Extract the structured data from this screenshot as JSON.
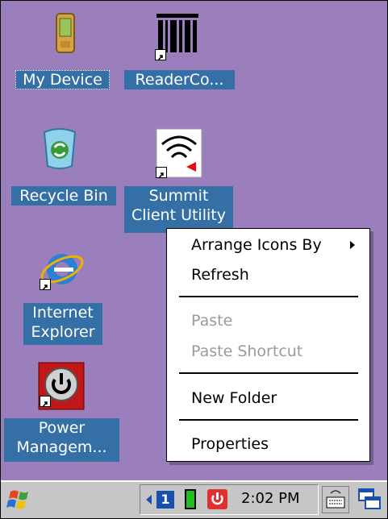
{
  "desktop": {
    "background": "#9b7fbd",
    "icons": [
      {
        "label": "My Device",
        "icon": "pda-device-icon"
      },
      {
        "label": "ReaderCo...",
        "icon": "barcode-reader-icon",
        "shortcut": true
      },
      {
        "label": "Recycle Bin",
        "icon": "recycle-bin-icon"
      },
      {
        "label_line1": "Summit",
        "label_line2": "Client Utility",
        "icon": "wireless-utility-icon",
        "shortcut": true
      },
      {
        "label_line1": "Internet",
        "label_line2": "Explorer",
        "icon": "internet-explorer-icon",
        "shortcut": true
      },
      {
        "label_line1": "Power",
        "label_line2": "Managem...",
        "icon": "power-icon",
        "shortcut": true
      }
    ]
  },
  "context_menu": {
    "items": [
      {
        "label": "Arrange Icons By",
        "enabled": true,
        "submenu": true
      },
      {
        "label": "Refresh",
        "enabled": true
      },
      {
        "label": "Paste",
        "enabled": false
      },
      {
        "label": "Paste Shortcut",
        "enabled": false
      },
      {
        "label": "New Folder",
        "enabled": true
      },
      {
        "label": "Properties",
        "enabled": true
      }
    ]
  },
  "taskbar": {
    "start_icon": "windows-flag-icon",
    "tray_icons": [
      "arrow-left-icon",
      "desktop-1-icon",
      "battery-icon",
      "power-tray-icon"
    ],
    "badge_number": "1",
    "clock": "2:02 PM",
    "keyboard_icon": "keyboard-icon",
    "desktop_switch_icon": "window-switch-icon"
  },
  "colors": {
    "selection": "#3470a6",
    "menu_disabled": "#9a9a9a",
    "taskbar": "#c6c6c6"
  }
}
